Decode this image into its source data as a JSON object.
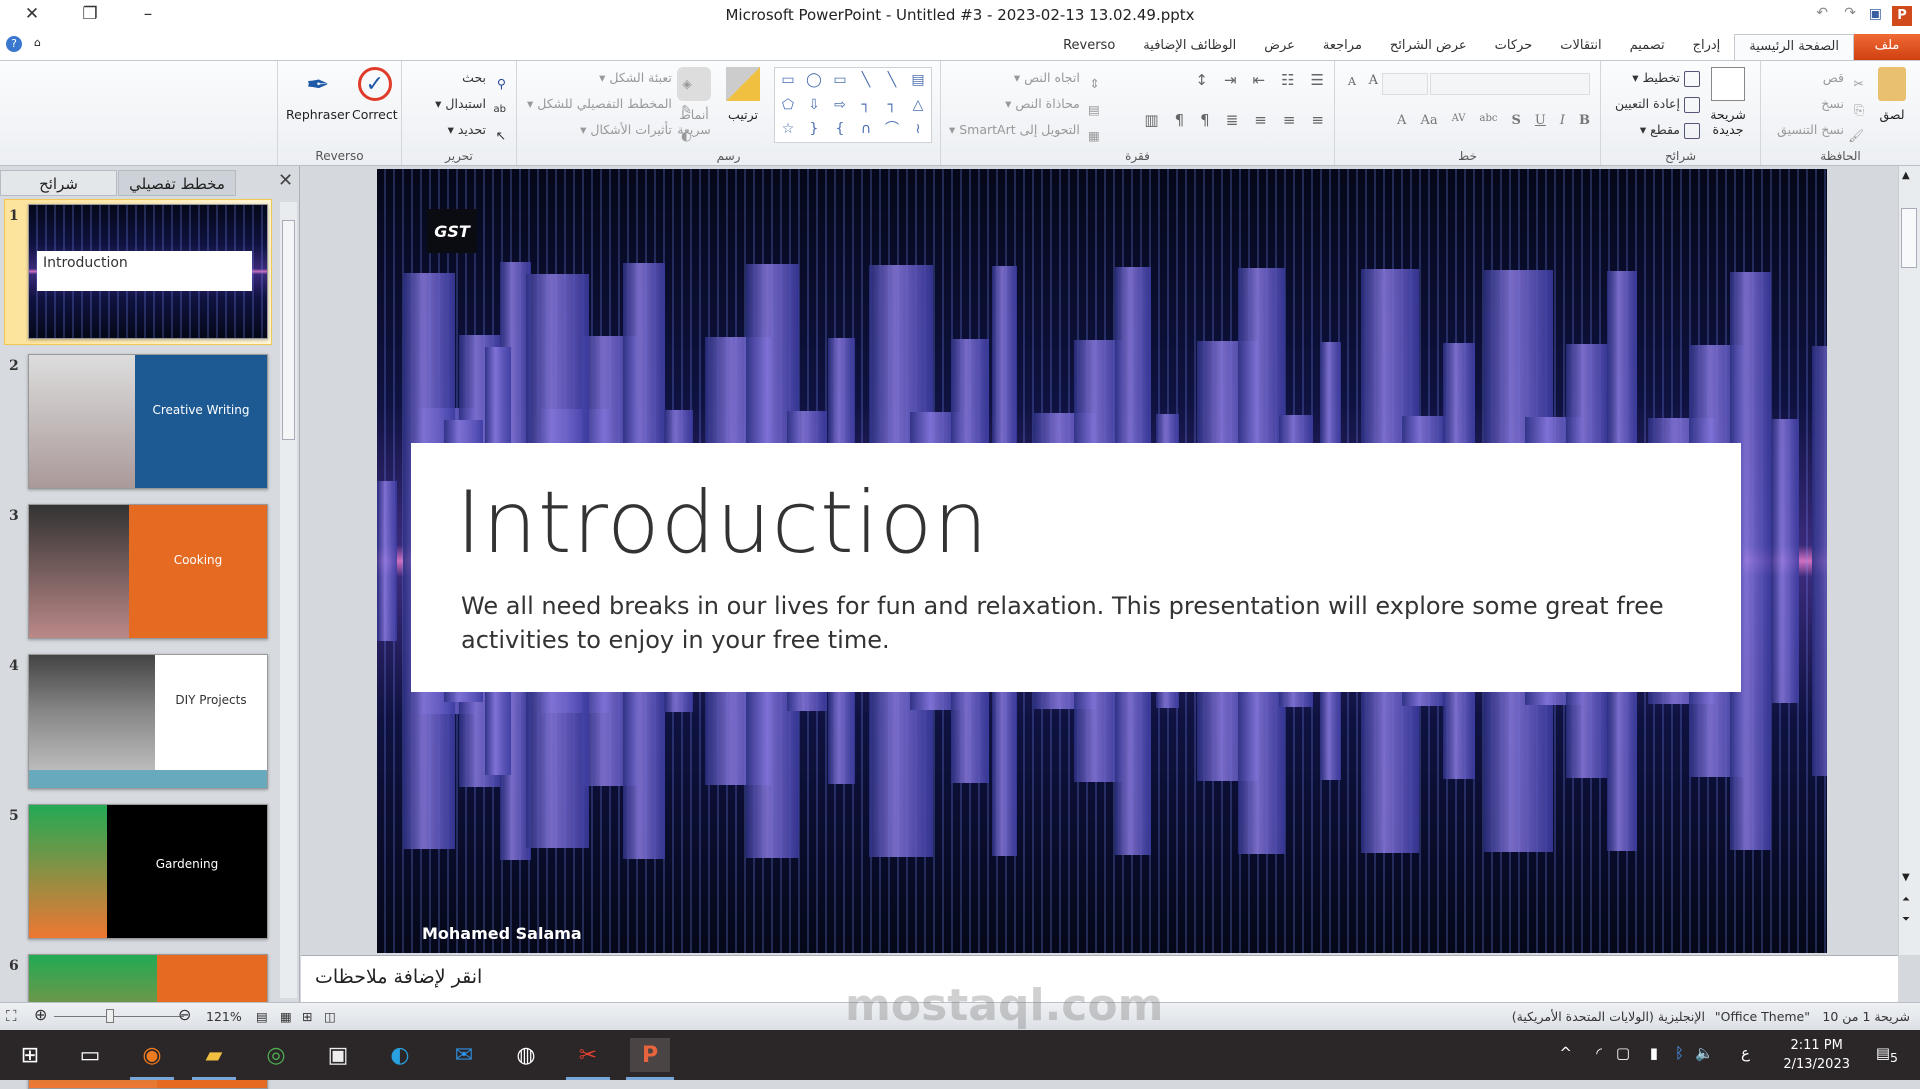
{
  "window": {
    "title": "Microsoft PowerPoint  -  Untitled #3 - 2023-02-13 13.02.49.pptx"
  },
  "tabs": [
    {
      "label": "ملف"
    },
    {
      "label": "الصفحة الرئيسية"
    },
    {
      "label": "إدراج"
    },
    {
      "label": "تصميم"
    },
    {
      "label": "انتقالات"
    },
    {
      "label": "حركات"
    },
    {
      "label": "عرض الشرائح"
    },
    {
      "label": "مراجعة"
    },
    {
      "label": "عرض"
    },
    {
      "label": "الوظائف الإضافية"
    },
    {
      "label": "Reverso"
    }
  ],
  "ribbon": {
    "clipboard": {
      "label": "الحافظة",
      "paste": "لصق",
      "cut": "قص",
      "copy": "نسخ",
      "format_painter": "نسخ التنسيق"
    },
    "slides": {
      "label": "شرائح",
      "new_slide": "شريحة جديدة",
      "layout": "تخطيط",
      "reset": "إعادة التعيين",
      "section": "مقطع"
    },
    "font": {
      "label": "خط",
      "bold": "B",
      "italic": "I",
      "underline": "U",
      "shadow": "S",
      "strike": "abc",
      "spacing": "AV",
      "case": "Aa",
      "color": "A",
      "grow": "A",
      "shrink": "A"
    },
    "paragraph": {
      "label": "فقرة",
      "text_direction": "اتجاه النص",
      "align_text": "محاذاة النص",
      "smartart": "التحويل إلى SmartArt"
    },
    "drawing": {
      "label": "رسم",
      "arrange": "ترتيب",
      "quick_styles": "أنماط سريعة",
      "shape_fill": "تعبئة الشكل",
      "shape_outline": "المخطط التفصيلي للشكل",
      "shape_effects": "تأثيرات الأشكال"
    },
    "editing": {
      "label": "تحرير",
      "find": "بحث",
      "replace": "استبدال",
      "select": "تحديد"
    },
    "reverso": {
      "label": "Reverso",
      "rephraser": "Rephraser",
      "correct": "Correct"
    }
  },
  "pane": {
    "tab_slides": "شرائح",
    "tab_outline": "مخطط تفصيلي",
    "thumbnails": [
      {
        "num": "1",
        "title": "Introduction",
        "color": "#0b0d2e"
      },
      {
        "num": "2",
        "title": "Creative Writing",
        "color": "#1d5a93"
      },
      {
        "num": "3",
        "title": "Cooking",
        "color": "#e56b22"
      },
      {
        "num": "4",
        "title": "DIY Projects",
        "color": "#ffffff"
      },
      {
        "num": "5",
        "title": "Gardening",
        "color": "#000000"
      },
      {
        "num": "6",
        "title": "",
        "color": "#e56b22"
      }
    ]
  },
  "slide": {
    "logo": "GST",
    "title": "Introduction",
    "body": "We all need breaks in our lives for fun and relaxation. This presentation will explore some great free activities to enjoy in your free time.",
    "author": "Mohamed Salama"
  },
  "notes": {
    "placeholder": "انقر لإضافة ملاحظات"
  },
  "status": {
    "slide_of": "شريحة 1 من 10",
    "theme": "\"Office Theme\"",
    "language": "الإنجليزية (الولايات المتحدة الأمريكية)",
    "zoom": "121%"
  },
  "taskbar": {
    "time": "2:11 PM",
    "date": "2/13/2023",
    "notifications": "5",
    "lang": "ع"
  },
  "watermark": "mostaql.com"
}
